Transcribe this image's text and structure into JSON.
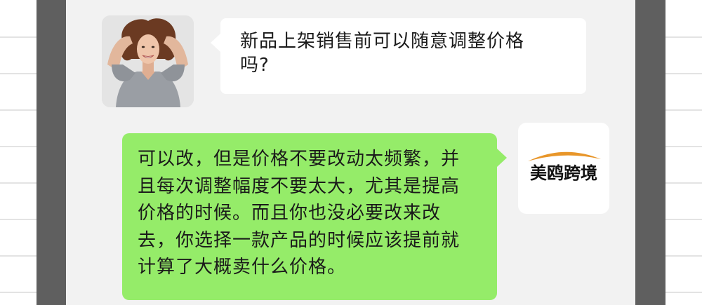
{
  "conversation": {
    "incoming_message": {
      "lines": [
        "新品上架销售前可以随意调整价格",
        "吗?"
      ]
    },
    "outgoing_message": {
      "lines": [
        "可以改，但是价格不要改动太频繁，并",
        "且每次调整幅度不要太大，尤其是提高",
        "价格的时候。而且你也没必要改来改",
        "去，你选择一款产品的时候应该提前就",
        "计算了大概卖什么价格。"
      ]
    },
    "brand_avatar": {
      "name": "美鸥跨境",
      "arc_color": "#e8962a"
    }
  },
  "colors": {
    "frame": "#5f5f5f",
    "chat_background": "#f2f2f2",
    "incoming_bubble": "#ffffff",
    "outgoing_bubble": "#95ec69"
  }
}
